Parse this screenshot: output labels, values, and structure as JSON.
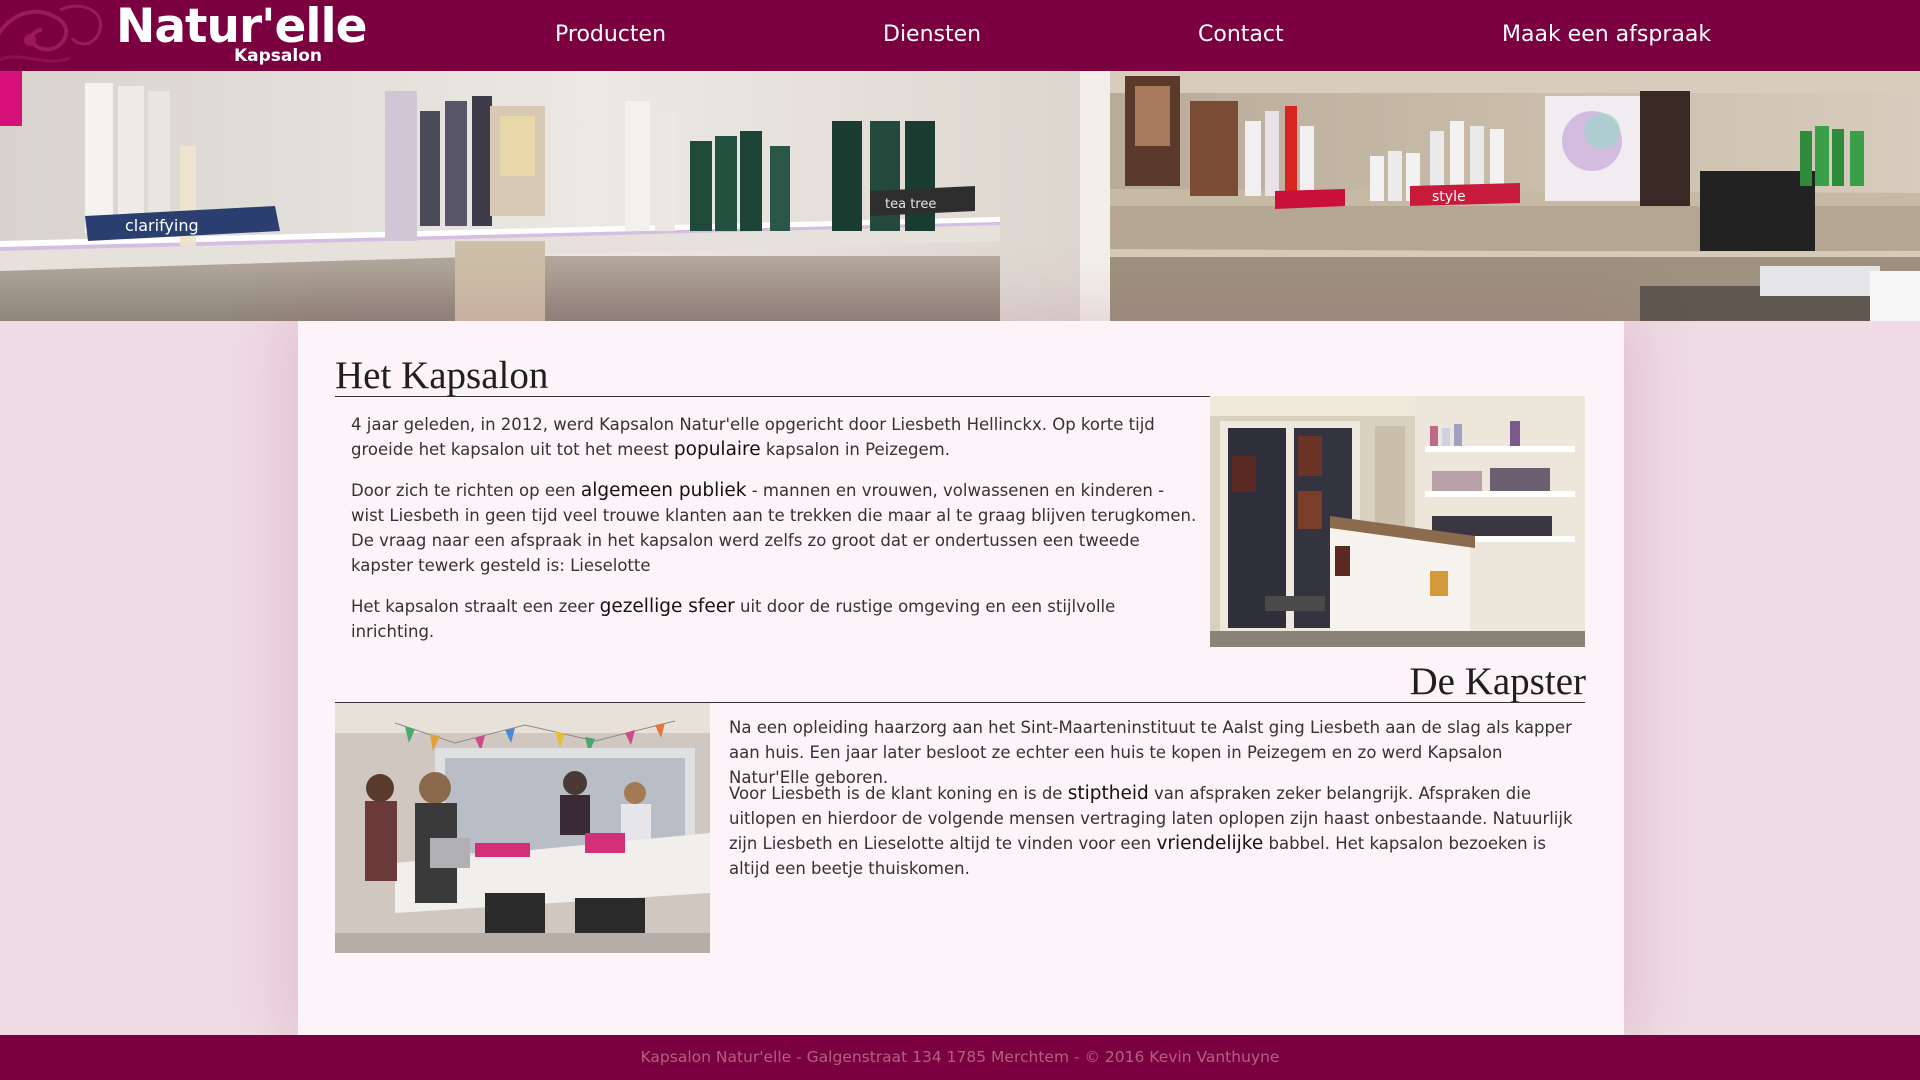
{
  "header": {
    "logo_main": "Natur'elle",
    "logo_sub": "Kapsalon",
    "nav": [
      {
        "label": "Producten"
      },
      {
        "label": "Diensten"
      },
      {
        "label": "Contact"
      },
      {
        "label": "Maak een afspraak"
      }
    ]
  },
  "hero": {
    "shelf_labels": [
      "clarifying",
      "tea tree",
      "style"
    ]
  },
  "sections": {
    "kapsalon": {
      "title": "Het Kapsalon",
      "p1_a": "4 jaar geleden, in 2012, werd Kapsalon Natur'elle opgericht door Liesbeth Hellinckx. Op korte tijd groeide het kapsalon uit tot het meest ",
      "p1_em": "populaire",
      "p1_b": " kapsalon in Peizegem.",
      "p2_a": "Door zich te richten op een ",
      "p2_em": "algemeen publiek",
      "p2_b": " - mannen en vrouwen, volwassenen en kinderen - wist Liesbeth in geen tijd veel trouwe klanten aan te trekken die maar al te graag blijven terugkomen. De vraag naar een afspraak in het kapsalon werd zelfs zo groot dat er ondertussen een tweede kapster tewerk gesteld is: Lieselotte",
      "p3_a": "Het kapsalon straalt een zeer ",
      "p3_em": "gezellige sfeer",
      "p3_b": " uit door de rustige omgeving en een stijlvolle inrichting."
    },
    "kapster": {
      "title": "De Kapster",
      "p1": "Na een opleiding haarzorg aan het Sint-Maarteninstituut te Aalst ging Liesbeth aan de slag als kapper aan huis. Een jaar later besloot ze echter een huis te kopen in Peizegem en zo werd Kapsalon Natur'Elle geboren.",
      "p2_a": "Voor Liesbeth is de klant koning en is de ",
      "p2_em": "stiptheid",
      "p2_b": " van afspraken zeker belangrijk. Afspraken die uitlopen en hierdoor de volgende mensen vertraging laten oplopen zijn haast onbestaande. Natuurlijk zijn Liesbeth en Lieselotte altijd te vinden voor een ",
      "p2_em2": "vriendelijke",
      "p2_c": " babbel. Het kapsalon bezoeken is altijd een beetje thuiskomen."
    }
  },
  "footer": {
    "text": "Kapsalon Natur'elle - Galgenstraat 134 1785 Merchtem - © 2016 Kevin Vanthuyne"
  },
  "colors": {
    "brand": "#7b0040",
    "page_bg": "#efdbe4",
    "card_bg": "#fcf4f8",
    "footer_text": "#b1617f"
  },
  "icons": [
    "logo-swirl-icon"
  ]
}
